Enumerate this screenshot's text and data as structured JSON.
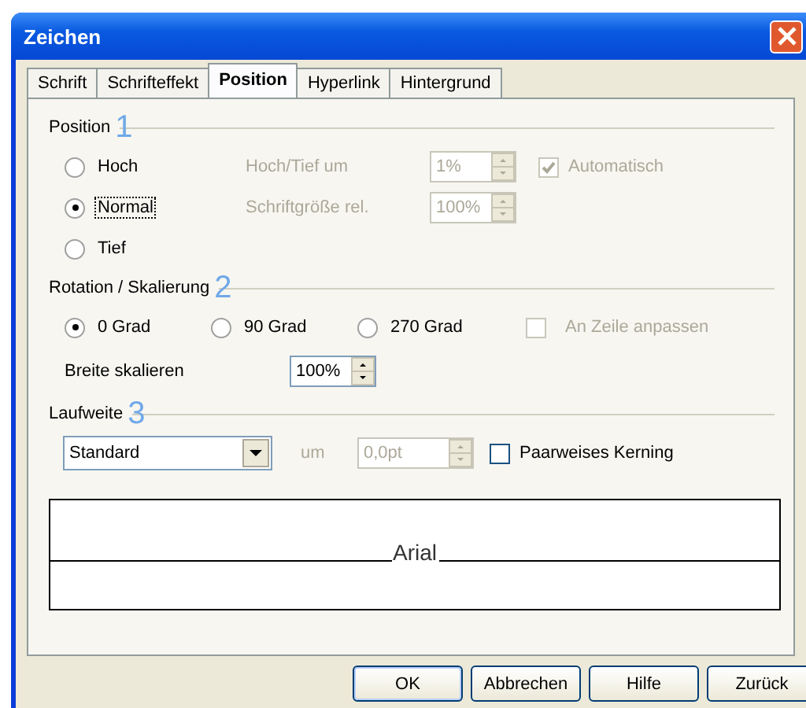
{
  "window": {
    "title": "Zeichen"
  },
  "tabs": [
    {
      "label": "Schrift",
      "selected": false
    },
    {
      "label": "Schrifteffekt",
      "selected": false
    },
    {
      "label": "Position",
      "selected": true
    },
    {
      "label": "Hyperlink",
      "selected": false
    },
    {
      "label": "Hintergrund",
      "selected": false
    }
  ],
  "position": {
    "title": "Position",
    "marker": "1",
    "options": [
      {
        "label": "Hoch",
        "selected": false,
        "focused": false
      },
      {
        "label": "Normal",
        "selected": true,
        "focused": true
      },
      {
        "label": "Tief",
        "selected": false,
        "focused": false
      }
    ],
    "fields": [
      {
        "label": "Hoch/Tief um",
        "value": "1%",
        "disabled": true
      },
      {
        "label": "Schriftgröße rel.",
        "value": "100%",
        "disabled": true
      }
    ],
    "automatic": {
      "label": "Automatisch",
      "checked": true,
      "disabled": true
    }
  },
  "rotation": {
    "title": "Rotation / Skalierung",
    "marker": "2",
    "options": [
      {
        "label": "0 Grad",
        "selected": true
      },
      {
        "label": "90 Grad",
        "selected": false
      },
      {
        "label": "270 Grad",
        "selected": false
      }
    ],
    "fit": {
      "label": "An Zeile anpassen",
      "checked": false,
      "disabled": true
    },
    "scale": {
      "label": "Breite skalieren",
      "value": "100%",
      "disabled": false
    }
  },
  "spacing": {
    "title": "Laufweite",
    "marker": "3",
    "dropdown": "Standard",
    "by": {
      "label": "um",
      "value": "0,0pt",
      "disabled": true
    },
    "kerning": {
      "label": "Paarweises Kerning",
      "checked": false,
      "disabled": false
    }
  },
  "preview": {
    "text": "Arial"
  },
  "buttons": [
    "OK",
    "Abbrechen",
    "Hilfe",
    "Zurück"
  ]
}
